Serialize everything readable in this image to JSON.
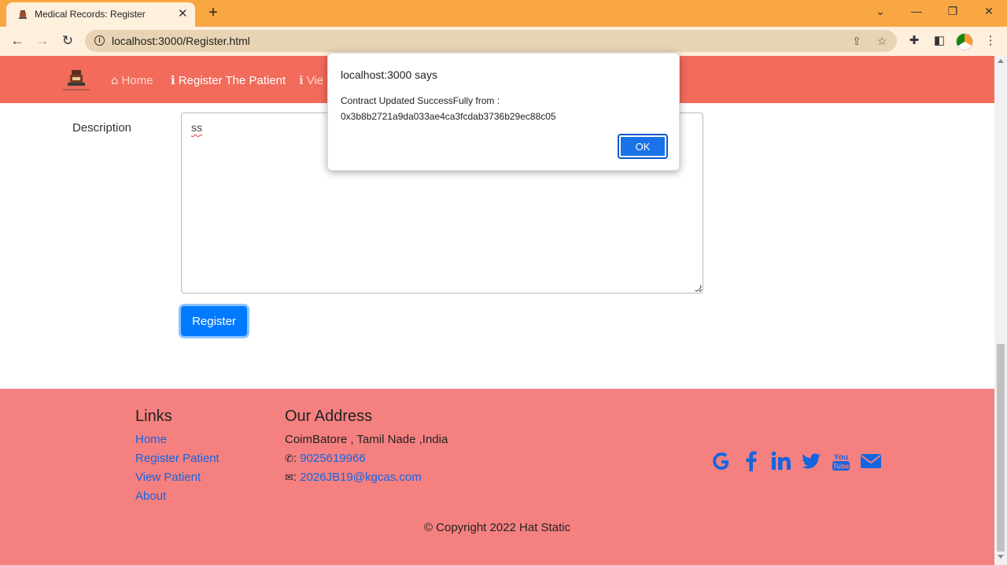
{
  "browser": {
    "tab_title": "Medical Records: Register",
    "url": "localhost:3000/Register.html",
    "colors": {
      "tabbar": "#f9a742",
      "toolbar": "#fff0de"
    }
  },
  "navbar": {
    "links": [
      {
        "label": "Home",
        "icon": "home-icon"
      },
      {
        "label": "Register The Patient",
        "icon": "info-icon"
      },
      {
        "label": "Vie",
        "icon": "info-icon"
      }
    ],
    "color": "#f26b5b"
  },
  "form": {
    "description_label": "Description",
    "description_value": "ss",
    "register_button": "Register"
  },
  "footer": {
    "links_heading": "Links",
    "links": [
      "Home",
      "Register Patient",
      "View Patient",
      "About"
    ],
    "address_heading": "Our Address",
    "address": "CoimBatore , Tamil Nade ,India",
    "phone": "9025619966",
    "phone_sep": ":",
    "email": "2026JB19@kgcas.com",
    "email_sep": ":",
    "social_icons": [
      "google-icon",
      "facebook-icon",
      "linkedin-icon",
      "twitter-icon",
      "youtube-icon",
      "envelope-icon"
    ],
    "copyright": "© Copyright 2022 Hat Static",
    "color": "#f58080"
  },
  "dialog": {
    "title": "localhost:3000 says",
    "message_line1": "Contract Updated SuccessFully from :",
    "message_line2": "0x3b8b2721a9da033ae4ca3fcdab3736b29ec88c05",
    "ok_label": "OK"
  }
}
